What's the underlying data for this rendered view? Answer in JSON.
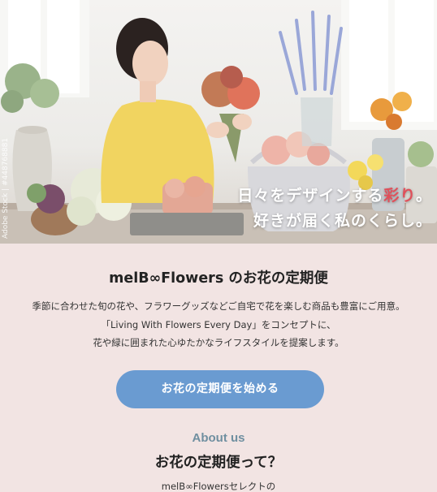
{
  "hero": {
    "stock_watermark": "Adobe Stock | #448768881",
    "tagline_line1_prefix": "日々をデザインする",
    "tagline_line1_accent": "彩り",
    "tagline_line1_suffix": "。",
    "tagline_line2": "好きが届く私のくらし。"
  },
  "intro": {
    "title": "melB∞Flowers のお花の定期便",
    "desc_line1": "季節に合わせた旬の花や、フラワーグッズなどご自宅で花を楽しむ商品も豊富にご用意。",
    "desc_line2": "「Living With Flowers Every Day」をコンセプトに、",
    "desc_line3": "花や緑に囲まれた心ゆたかなライフスタイルを提案します。"
  },
  "cta": {
    "label": "お花の定期便を始める"
  },
  "about": {
    "eyebrow": "About us",
    "title": "お花の定期便って？",
    "text": "melB∞Flowersセレクトの"
  },
  "colors": {
    "background": "#f2e4e3",
    "button": "#6a9bd1",
    "accent_red": "#e0505a",
    "eyebrow": "#6f8fa0"
  }
}
